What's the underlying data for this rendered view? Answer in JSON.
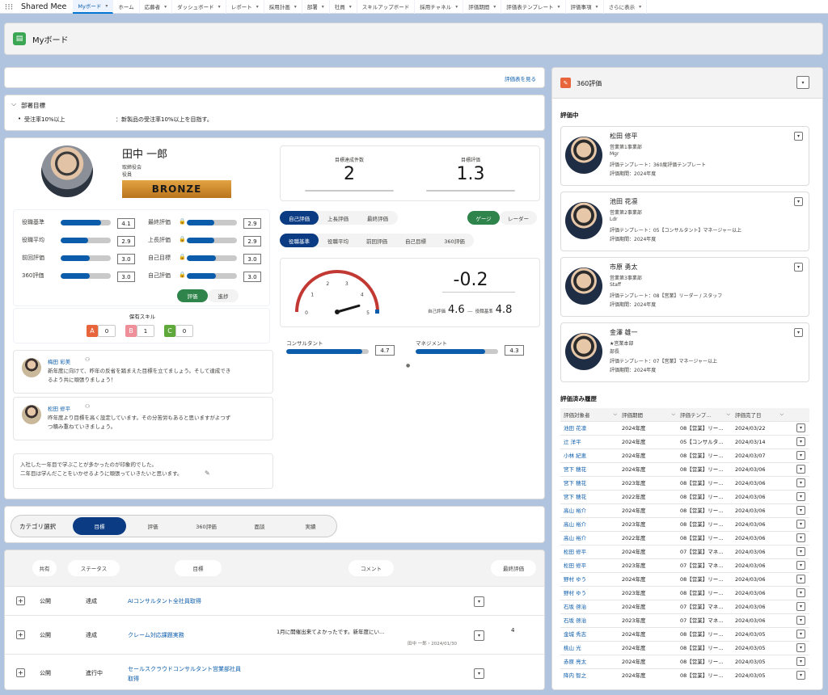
{
  "nav": {
    "app_name": "Shared Mee",
    "items": [
      {
        "label": "Myボード",
        "active": true,
        "chevron": true
      },
      {
        "label": "ホーム",
        "chevron": false
      },
      {
        "label": "応募者",
        "chevron": true
      },
      {
        "label": "ダッシュボード",
        "chevron": true
      },
      {
        "label": "レポート",
        "chevron": true
      },
      {
        "label": "採用計画",
        "chevron": true
      },
      {
        "label": "部署",
        "chevron": true
      },
      {
        "label": "社員",
        "chevron": true
      },
      {
        "label": "スキルアップボード",
        "chevron": false
      },
      {
        "label": "採用チャネル",
        "chevron": true
      },
      {
        "label": "評価期間",
        "chevron": true
      },
      {
        "label": "評価表テンプレート",
        "chevron": true
      },
      {
        "label": "評価事項",
        "chevron": true
      },
      {
        "label": "さらに表示",
        "chevron": true
      }
    ]
  },
  "header": {
    "title": "Myボード"
  },
  "eval_link": "評価表を見る",
  "dept": {
    "title": "部署目標",
    "goal_name": "受注率10%以上",
    "goal_desc": "：新製品の受注率10%以上を目指す。"
  },
  "profile": {
    "name": "田中 一郎",
    "title1": "取締役会",
    "title2": "役員",
    "rank": "BRONZE"
  },
  "metrics_left": [
    {
      "label": "役職基準",
      "value": "4.1",
      "fill": 0.8
    },
    {
      "label": "役職平均",
      "value": "2.9",
      "fill": 0.55
    },
    {
      "label": "前回評価",
      "value": "3.0",
      "fill": 0.58
    },
    {
      "label": "360評価",
      "value": "3.0",
      "fill": 0.58
    }
  ],
  "metrics_right": [
    {
      "label": "最終評価",
      "value": "2.9",
      "fill": 0.55
    },
    {
      "label": "上長評価",
      "value": "2.9",
      "fill": 0.55
    },
    {
      "label": "自己目標",
      "value": "3.0",
      "fill": 0.58
    },
    {
      "label": "自己評価",
      "value": "3.0",
      "fill": 0.58
    }
  ],
  "toggle_eval": {
    "a": "評価",
    "b": "進捗"
  },
  "skills": {
    "title": "保有スキル",
    "items": [
      {
        "letter": "A",
        "count": "0",
        "color": "#e8643a"
      },
      {
        "letter": "B",
        "count": "1",
        "color": "#ef8f9a"
      },
      {
        "letter": "C",
        "count": "0",
        "color": "#5fa83a"
      }
    ]
  },
  "kpi": [
    {
      "label": "目標達成件数",
      "value": "2"
    },
    {
      "label": "目標評価",
      "value": "1.3"
    }
  ],
  "eval_tabs": [
    "自己評価",
    "上長評価",
    "最終評価"
  ],
  "view_toggle": {
    "a": "ゲージ",
    "b": "レーダー"
  },
  "compare_tabs": [
    "役職基準",
    "役職平均",
    "前回評価",
    "自己目標",
    "360評価"
  ],
  "gauge": {
    "ticks": [
      "0",
      "1",
      "2",
      "3",
      "4",
      "5"
    ],
    "value": -0.2,
    "diff": "-0.2",
    "self_label": "自己評価",
    "self_value": "4.6",
    "std_label": "役職基準",
    "std_value": "4.8",
    "sep": "—"
  },
  "skill_bars": [
    {
      "label": "コンサルタント",
      "value": "4.7",
      "fill": 0.92
    },
    {
      "label": "マネジメント",
      "value": "4.3",
      "fill": 0.84
    }
  ],
  "comments": [
    {
      "name": "梅田 彩美",
      "text1": "新年度に向けて、昨年の反省を踏まえた目標を立てましょう。そして達成でき",
      "text2": "るよう共に頑張りましょう！"
    },
    {
      "name": "松田 修平",
      "text1": "昨年度より目標を高く設定しています。その分苦労もあると思いますがよつず",
      "text2": "つ積み重ねていきましょう。"
    }
  ],
  "note": {
    "line1": "入社した一年目で学ぶことが多かったのが印象的でした。",
    "line2": "二年目は学んだことをいかせるように頑張っていきたいと思います。"
  },
  "category": {
    "label": "カテゴリ選択",
    "tabs": [
      "目標",
      "評価",
      "360評価",
      "面談",
      "実績"
    ]
  },
  "goals": {
    "columns": [
      "共有",
      "ステータス",
      "目標",
      "コメント",
      "最終評価"
    ],
    "rows": [
      {
        "share": "公開",
        "status": "達成",
        "title1": "AIコンサルタント全社員取得",
        "title2": "",
        "comment": "",
        "commenter": "",
        "score": ""
      },
      {
        "share": "公開",
        "status": "達成",
        "title1": "クレーム対応課題実務",
        "title2": "",
        "comment": "1月に開催出来てよかったです。新年度にい…",
        "commenter": "田中 一郎・2024/01/30",
        "score": "4"
      },
      {
        "share": "公開",
        "status": "進行中",
        "title1": "セールスクラウドコンサルタント営業部社員",
        "title2": "取得",
        "comment": "",
        "commenter": "",
        "score": ""
      }
    ]
  },
  "panel360": {
    "title": "360評価",
    "in_progress": "評価中",
    "people": [
      {
        "name": "松田 修平",
        "dept": "営業第1事業部",
        "role": "Mgr",
        "template": "評価テンプレート：360度評価テンプレート",
        "period": "評価期間：2024年度"
      },
      {
        "name": "池田 花凛",
        "dept": "営業第2事業部",
        "role": "Ldr",
        "template": "評価テンプレート：05【コンサルタント】マネージャー以上",
        "period": "評価期間：2024年度"
      },
      {
        "name": "市原 勇太",
        "dept": "営業第3事業部",
        "role": "Staff",
        "template": "評価テンプレート：08【営業】リーダー / スタッフ",
        "period": "評価期間：2024年度"
      },
      {
        "name": "金澤 雄一",
        "dept": "★営業本部",
        "role": "部長",
        "template": "評価テンプレート：07【営業】マネージャー以上",
        "period": "評価期間：2024年度"
      }
    ],
    "history_title": "評価済み履歴",
    "history_columns": [
      "評価対象者",
      "評価期間",
      "評価テンプ…",
      "評価完了日"
    ],
    "history": [
      [
        "池田 花凛",
        "2024年度",
        "08【営業】リー…",
        "2024/03/22"
      ],
      [
        "辻 洋平",
        "2024年度",
        "05【コンサルタ…",
        "2024/03/14"
      ],
      [
        "小林 紀恵",
        "2024年度",
        "08【営業】リー…",
        "2024/03/07"
      ],
      [
        "宮下 穂花",
        "2024年度",
        "08【営業】リー…",
        "2024/03/06"
      ],
      [
        "宮下 穂花",
        "2023年度",
        "08【営業】リー…",
        "2024/03/06"
      ],
      [
        "宮下 穂花",
        "2022年度",
        "08【営業】リー…",
        "2024/03/06"
      ],
      [
        "高山 裕介",
        "2024年度",
        "08【営業】リー…",
        "2024/03/06"
      ],
      [
        "高山 裕介",
        "2023年度",
        "08【営業】リー…",
        "2024/03/06"
      ],
      [
        "高山 裕介",
        "2022年度",
        "08【営業】リー…",
        "2024/03/06"
      ],
      [
        "松田 修平",
        "2024年度",
        "07【営業】マネ…",
        "2024/03/06"
      ],
      [
        "松田 修平",
        "2023年度",
        "07【営業】マネ…",
        "2024/03/06"
      ],
      [
        "野村 ゆう",
        "2024年度",
        "08【営業】リー…",
        "2024/03/06"
      ],
      [
        "野村 ゆう",
        "2023年度",
        "08【営業】リー…",
        "2024/03/06"
      ],
      [
        "石坂 啓治",
        "2024年度",
        "07【営業】マネ…",
        "2024/03/06"
      ],
      [
        "石坂 啓治",
        "2023年度",
        "07【営業】マネ…",
        "2024/03/06"
      ],
      [
        "金城 秀志",
        "2024年度",
        "08【営業】リー…",
        "2024/03/05"
      ],
      [
        "桃山 光",
        "2024年度",
        "08【営業】リー…",
        "2024/03/05"
      ],
      [
        "赤原 亮太",
        "2024年度",
        "08【営業】リー…",
        "2024/03/05"
      ],
      [
        "降内 智之",
        "2024年度",
        "08【営業】リー…",
        "2024/03/05"
      ]
    ]
  },
  "colors": {
    "accent": "#0b5cab",
    "dark_pill": "#0b3b82",
    "green": "#2e844a",
    "rank_gold": "#c98a2a",
    "bg": "#b0c4df"
  }
}
